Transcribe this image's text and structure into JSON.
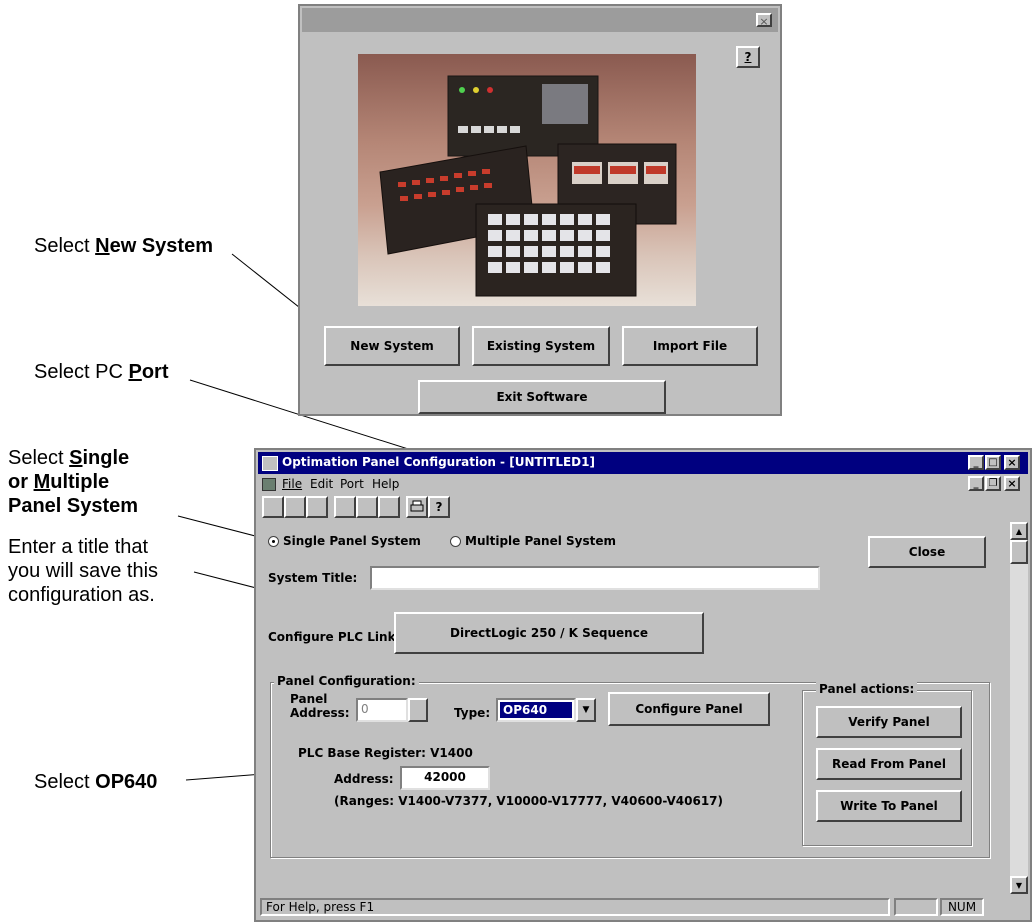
{
  "annotations": {
    "new_system": {
      "prefix": "Select ",
      "key": "N",
      "rest": "ew System"
    },
    "pc_port": {
      "prefix": "Select PC ",
      "key": "P",
      "rest": "ort"
    },
    "single_multiple": {
      "line1_prefix": "Select ",
      "line1_key": "S",
      "line1_rest": "ingle",
      "line2_prefix": "or ",
      "line2_key": "M",
      "line2_rest": "ultiple",
      "line3": "Panel System"
    },
    "title": {
      "line1": "Enter a title that",
      "line2": "you will save this",
      "line3": "configuration as."
    },
    "op640": {
      "prefix": "Select ",
      "bold": "OP640"
    }
  },
  "splash": {
    "close_glyph": "×",
    "help_button": "?",
    "buttons": {
      "new_system": "New System",
      "existing_system": "Existing System",
      "import_file": "Import File",
      "exit_software": "Exit Software"
    }
  },
  "main_window": {
    "title": "Optimation Panel Configuration - [UNTITLED1]",
    "title_controls": [
      "_",
      "□",
      "×"
    ],
    "doc_controls": [
      "_",
      "❐",
      "×"
    ],
    "menu": [
      "File",
      "Edit",
      "Port",
      "Help"
    ],
    "radio_single": "Single Panel System",
    "radio_multiple": "Multiple Panel System",
    "close_button": "Close",
    "system_title_label": "System Title:",
    "system_title_value": "",
    "plc_link_label": "Configure PLC Link:",
    "plc_link_button": "DirectLogic 250 / K Sequence",
    "panel_config_group": "Panel Configuration:",
    "panel_address_label1": "Panel",
    "panel_address_label2": "Address:",
    "panel_address_value": "0",
    "type_label": "Type:",
    "type_value": "OP640",
    "configure_panel_button": "Configure Panel",
    "plc_base_register": "PLC Base Register: V1400",
    "address_label": "Address:",
    "address_value": "42000",
    "ranges": "(Ranges: V1400-V7377, V10000-V17777, V40600-V40617)",
    "panel_actions_group": "Panel actions:",
    "verify_button": "Verify Panel",
    "read_button": "Read From Panel",
    "write_button": "Write To Panel",
    "status_text": "For Help, press F1",
    "status_num": "NUM"
  },
  "colors": {
    "titlebar": "#000080",
    "face": "#c0c0c0",
    "type_highlight": "#000080"
  }
}
